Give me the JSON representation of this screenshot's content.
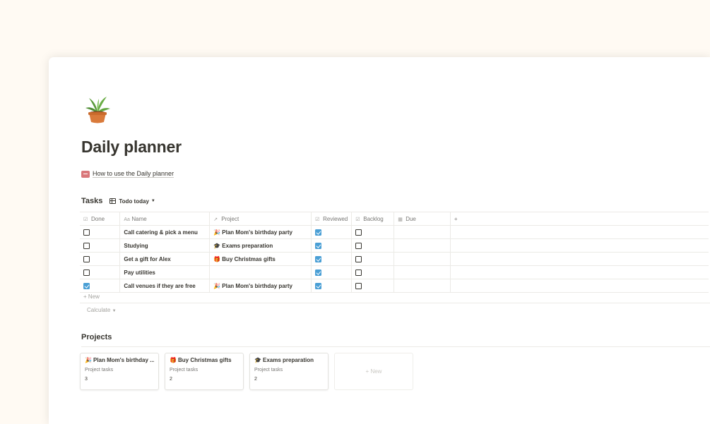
{
  "page": {
    "title": "Daily planner",
    "icon": "potted-plant-icon",
    "guide_link": "How to use the Daily planner"
  },
  "tasks": {
    "title": "Tasks",
    "view_name": "Todo today",
    "columns": [
      {
        "label": "Done",
        "icon": "checkbox-icon"
      },
      {
        "label": "Name",
        "icon": "text-icon"
      },
      {
        "label": "Project",
        "icon": "relation-arrow-icon"
      },
      {
        "label": "Reviewed",
        "icon": "checkbox-icon"
      },
      {
        "label": "Backlog",
        "icon": "checkbox-icon"
      },
      {
        "label": "Due",
        "icon": "calendar-icon"
      }
    ],
    "rows": [
      {
        "done": false,
        "name": "Call catering & pick a menu",
        "project": "Plan Mom's birthday party",
        "project_icon": "party-popper-icon",
        "reviewed": true,
        "backlog": false,
        "due": ""
      },
      {
        "done": false,
        "name": "Studying",
        "project": "Exams preparation",
        "project_icon": "graduation-cap-icon",
        "reviewed": true,
        "backlog": false,
        "due": ""
      },
      {
        "done": false,
        "name": "Get a gift for Alex",
        "project": "Buy Christmas gifts",
        "project_icon": "gift-icon",
        "reviewed": true,
        "backlog": false,
        "due": ""
      },
      {
        "done": false,
        "name": "Pay utilities",
        "project": "",
        "project_icon": "",
        "reviewed": true,
        "backlog": false,
        "due": ""
      },
      {
        "done": true,
        "name": "Call venues if they are free",
        "project": "Plan Mom's birthday party",
        "project_icon": "party-popper-icon",
        "reviewed": true,
        "backlog": false,
        "due": ""
      }
    ],
    "new_label": "+ New",
    "calculate_label": "Calculate"
  },
  "projects": {
    "title": "Projects",
    "cards": [
      {
        "title": "Plan Mom's birthday ...",
        "icon": "party-popper-icon",
        "label": "Project tasks",
        "value": "3"
      },
      {
        "title": "Buy Christmas gifts",
        "icon": "gift-icon",
        "label": "Project tasks",
        "value": "2"
      },
      {
        "title": "Exams preparation",
        "icon": "graduation-cap-icon",
        "label": "Project tasks",
        "value": "2"
      }
    ],
    "new_label": "+ New"
  },
  "colors": {
    "background": "#fffaf3",
    "checkbox_checked": "#4a9fd5",
    "guide_icon": "#d9777a",
    "text": "#37352f"
  }
}
